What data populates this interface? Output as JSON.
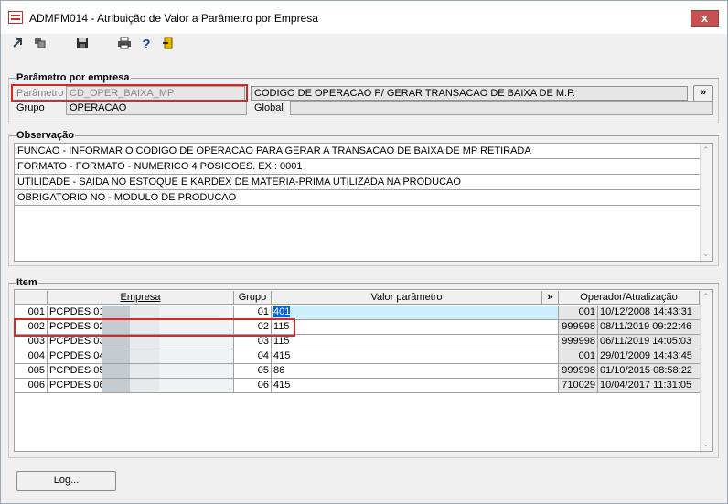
{
  "window": {
    "title": "ADMFM014 - Atribuição de Valor a Parâmetro por Empresa",
    "close_glyph": "x"
  },
  "toolbar": {
    "icons": [
      "arrow-import-icon",
      "copy-icon",
      "save-icon",
      "print-icon",
      "help-icon",
      "exit-door-icon"
    ],
    "help_glyph": "?"
  },
  "parametro_section": {
    "title": "Parâmetro por empresa",
    "parametro_label": "Parâmetro",
    "parametro_value": "CD_OPER_BAIXA_MP",
    "descricao_value": "CODIGO DE OPERACAO P/ GERAR TRANSACAO DE BAIXA DE M.P.",
    "expand_label": "»",
    "grupo_label": "Grupo",
    "grupo_value": "OPERACAO",
    "global_label": "Global",
    "global_value": ""
  },
  "observacao_section": {
    "title": "Observação",
    "lines": [
      "FUNCAO - INFORMAR O CODIGO DE OPERACAO PARA GERAR A TRANSACAO DE BAIXA DE MP RETIRADA",
      "FORMATO - FORMATO - NUMERICO 4 POSICOES. EX.: 0001",
      "UTILIDADE - SAIDA NO ESTOQUE E KARDEX DE MATERIA-PRIMA UTILIZADA NA PRODUCAO",
      "OBRIGATORIO NO - MODULO DE PRODUCAO"
    ]
  },
  "item_section": {
    "title": "Item",
    "columns": {
      "empresa": "Empresa",
      "grupo": "Grupo",
      "valor": "Valor parâmetro",
      "expand": "»",
      "operador": "Operador/Atualização"
    },
    "rows": [
      {
        "code": "001",
        "empresa": "PCPDES 01",
        "grupo": "01",
        "valor": "401",
        "operador": "001",
        "atualizacao": "10/12/2008 14:43:31"
      },
      {
        "code": "002",
        "empresa": "PCPDES 02",
        "grupo": "02",
        "valor": "115",
        "operador": "999998",
        "atualizacao": "08/11/2019 09:22:46"
      },
      {
        "code": "003",
        "empresa": "PCPDES 03",
        "grupo": "03",
        "valor": "115",
        "operador": "999998",
        "atualizacao": "06/11/2019 14:05:03"
      },
      {
        "code": "004",
        "empresa": "PCPDES 04",
        "grupo": "04",
        "valor": "415",
        "operador": "001",
        "atualizacao": "29/01/2009 14:43:45"
      },
      {
        "code": "005",
        "empresa": "PCPDES 05",
        "grupo": "05",
        "valor": "86",
        "operador": "999998",
        "atualizacao": "01/10/2015 08:58:22"
      },
      {
        "code": "006",
        "empresa": "PCPDES 06",
        "grupo": "06",
        "valor": "415",
        "operador": "710029",
        "atualizacao": "10/04/2017 11:31:05"
      }
    ]
  },
  "footer": {
    "log_button": "Log..."
  },
  "colors": {
    "highlight_red": "#d62828",
    "selected_row": "#cdeffd",
    "selection_blue": "#0a64d8"
  }
}
